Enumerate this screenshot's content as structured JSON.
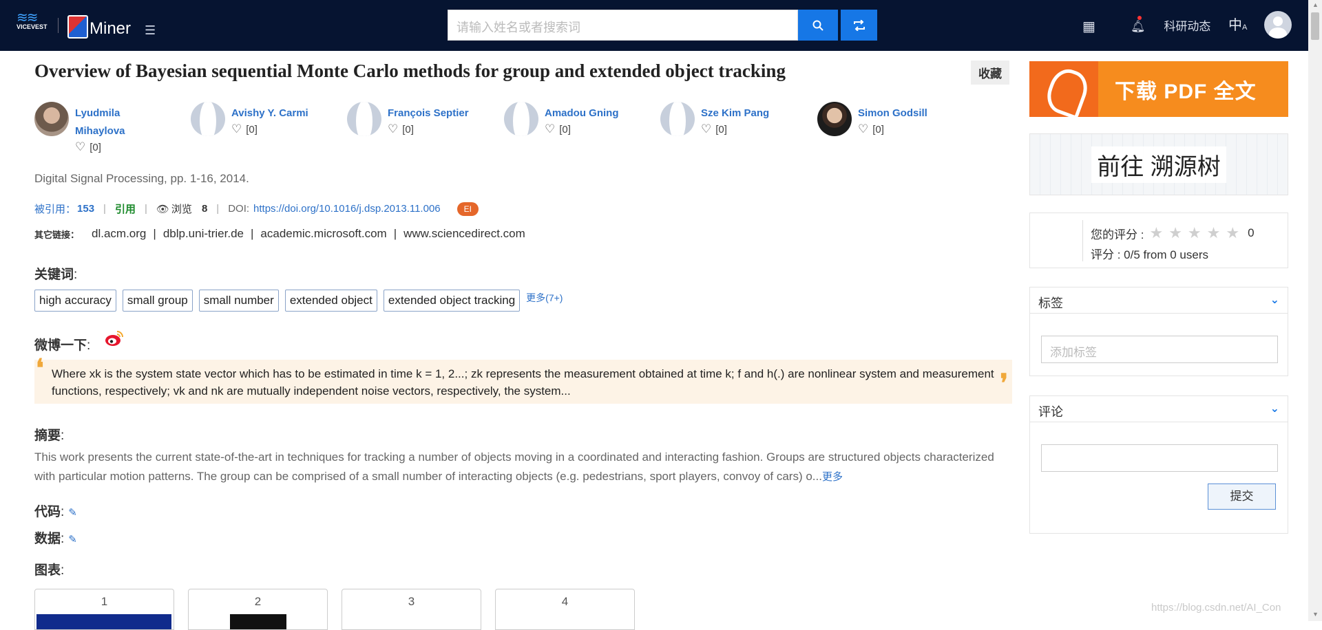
{
  "header": {
    "vice_logo_text": "VICEVEST",
    "aminer_logo_text": "Miner",
    "search_placeholder": "请输入姓名或者搜索词",
    "news_label": "科研动态",
    "lang_label": "中",
    "icons": [
      "vicevest-logo",
      "aminer-logo",
      "menu-toggle-icon",
      "search-icon",
      "swap-icon",
      "apps-grid-icon",
      "bell-icon",
      "language-icon",
      "user-avatar-icon"
    ]
  },
  "paper": {
    "title": "Overview of Bayesian sequential Monte Carlo methods for group and extended object tracking",
    "favorite_label": "收藏",
    "authors": [
      {
        "name_line1": "Lyudmila",
        "name_line2": "Mihaylova",
        "likes": "[0]",
        "photo": "photo"
      },
      {
        "name_line1": "Avishy Y. Carmi",
        "name_line2": "",
        "likes": "[0]",
        "photo": "placeholder"
      },
      {
        "name_line1": "François Septier",
        "name_line2": "",
        "likes": "[0]",
        "photo": "placeholder"
      },
      {
        "name_line1": "Amadou Gning",
        "name_line2": "",
        "likes": "[0]",
        "photo": "placeholder"
      },
      {
        "name_line1": "Sze Kim Pang",
        "name_line2": "",
        "likes": "[0]",
        "photo": "placeholder"
      },
      {
        "name_line1": "Simon Godsill",
        "name_line2": "",
        "likes": "[0]",
        "photo": "photo"
      }
    ],
    "venue": "Digital Signal Processing, pp. 1-16, 2014.",
    "cited_label": "被引用：",
    "cited_count": "153",
    "cite_label": "引用",
    "views_label": "浏览",
    "views_count": "8",
    "doi_label": "DOI:",
    "doi": "https://doi.org/10.1016/j.dsp.2013.11.006",
    "ei_badge": "EI",
    "other_links_label": "其它链接：",
    "other_links": [
      "dl.acm.org",
      "dblp.uni-trier.de",
      "academic.microsoft.com",
      "www.sciencedirect.com"
    ],
    "keywords_label": "关键词",
    "keywords": [
      "high accuracy",
      "small group",
      "small number",
      "extended object",
      "extended object tracking"
    ],
    "keywords_more": "更多(7+)",
    "weibo_label": "微博一下",
    "quote": "Where xk is the system state vector which has to be estimated in time k = 1, 2...; zk represents the measurement obtained at time k; f and h(.) are nonlinear system and measurement functions, respectively; vk and nk are mutually independent noise vectors, respectively, the system...",
    "abstract_label": "摘要",
    "abstract": "This work presents the current state-of-the-art in techniques for tracking a number of objects moving in a coordinated and interacting fashion. Groups are structured objects characterized with particular motion patterns. The group can be comprised of a small number of interacting objects (e.g. pedestrians, sport players, convoy of cars) o...",
    "abstract_more": "更多",
    "code_label": "代码",
    "data_label": "数据",
    "charts_label": "图表",
    "figures": [
      "1",
      "2",
      "3",
      "4"
    ]
  },
  "sidebar": {
    "pdf_label": "下载 PDF 全文",
    "tree_label": "前往 溯源树",
    "your_rating_label": "您的评分 :",
    "your_rating_value": "0",
    "rating_summary": "评分 : 0/5 from 0 users",
    "tags_title": "标签",
    "tags_placeholder": "添加标签",
    "comments_title": "评论",
    "submit_label": "提交"
  },
  "watermark": "https://blog.csdn.net/AI_Con"
}
